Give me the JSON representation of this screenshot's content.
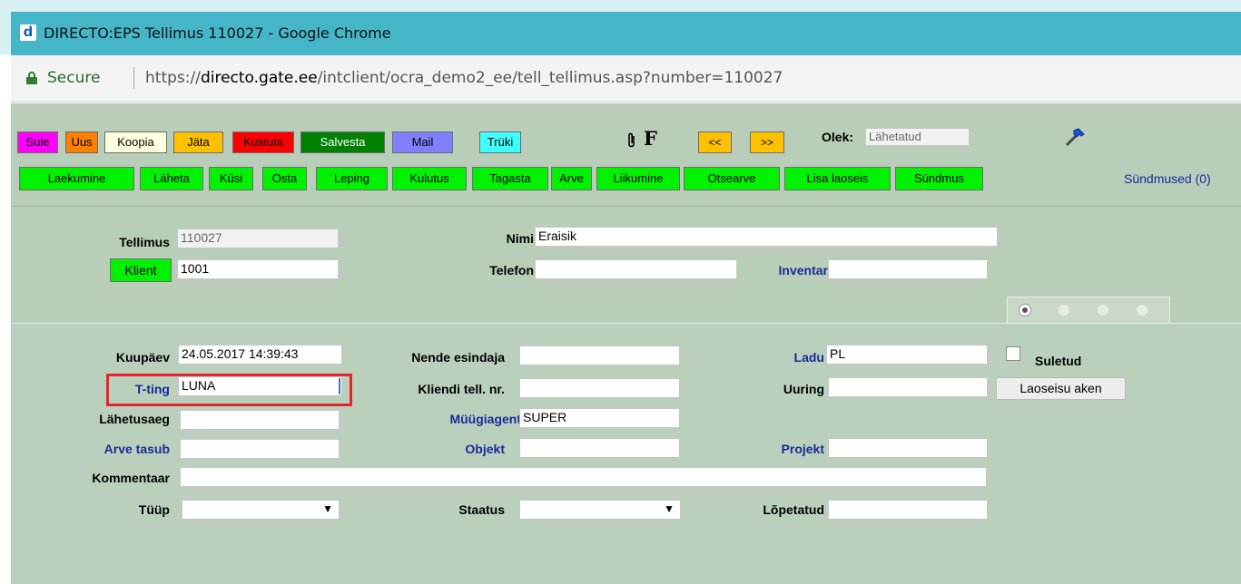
{
  "window": {
    "title": "DIRECTO:EPS Tellimus 110027 - Google Chrome"
  },
  "address": {
    "secure_label": "Secure",
    "url_scheme": "https://",
    "url_host": "directo.gate.ee",
    "url_path": "/intclient/ocra_demo2_ee/tell_tellimus.asp?number=110027"
  },
  "toolbar1": {
    "buttons": [
      {
        "label": "Sule",
        "color": "#ff00ff"
      },
      {
        "label": "Uus",
        "color": "#ff8000"
      },
      {
        "label": "Koopia",
        "color": "#ffffe0"
      },
      {
        "label": "Jäta",
        "color": "#ffc000"
      },
      {
        "label": "Kustuta",
        "color": "#ff0000"
      },
      {
        "label": "Salvesta",
        "color": "#008000"
      },
      {
        "label": "Mail",
        "color": "#8080ff"
      },
      {
        "label": "Trüki",
        "color": "#40ffff"
      }
    ],
    "attach_icon": "paperclip-icon",
    "f_label": "F",
    "prev_label": "<<",
    "next_label": ">>",
    "olek_label": "Olek:",
    "olek_value": "Lähetatud",
    "tools_icon": "hammer-icon"
  },
  "toolbar2": {
    "buttons": [
      "Laekumine",
      "Läheta",
      "Küsi",
      "Osta",
      "Leping",
      "Kulutus",
      "Tagasta",
      "Arve",
      "Liikumine",
      "Otsearve",
      "Lisa laoseis",
      "Sündmus"
    ],
    "events_link": "Sündmused (0)"
  },
  "header": {
    "tellimus_label": "Tellimus",
    "tellimus_value": "110027",
    "klient_button": "Klient",
    "klient_value": "1001",
    "nimi_label": "Nimi",
    "nimi_value": "Eraisik",
    "telefon_label": "Telefon",
    "telefon_value": "",
    "inventar_label": "Inventar",
    "inventar_value": ""
  },
  "tabs": {
    "count": 4,
    "active": 0
  },
  "details": {
    "kuupaev_label": "Kuupäev",
    "kuupaev_value": "24.05.2017 14:39:43",
    "tting_label": "T-ting",
    "tting_value": "LUNA",
    "lahetusaeg_label": "Lähetusaeg",
    "lahetusaeg_value": "",
    "arvetasub_label": "Arve tasub",
    "arvetasub_value": "",
    "kommentaar_label": "Kommentaar",
    "kommentaar_value": "",
    "tuup_label": "Tüüp",
    "tuup_value": "",
    "nende_label": "Nende esindaja",
    "nende_value": "",
    "kliendi_label": "Kliendi tell. nr.",
    "kliendi_value": "",
    "muugiagent_label": "Müügiagent",
    "muugiagent_value": "SUPER",
    "objekt_label": "Objekt",
    "objekt_value": "",
    "staatus_label": "Staatus",
    "staatus_value": "",
    "ladu_label": "Ladu",
    "ladu_value": "PL",
    "uuring_label": "Uuring",
    "uuring_value": "",
    "projekt_label": "Projekt",
    "projekt_value": "",
    "lopetatud_label": "Lõpetatud",
    "lopetatud_value": "",
    "suletud_label": "Suletud",
    "laoseisu_button": "Laoseisu aken"
  }
}
